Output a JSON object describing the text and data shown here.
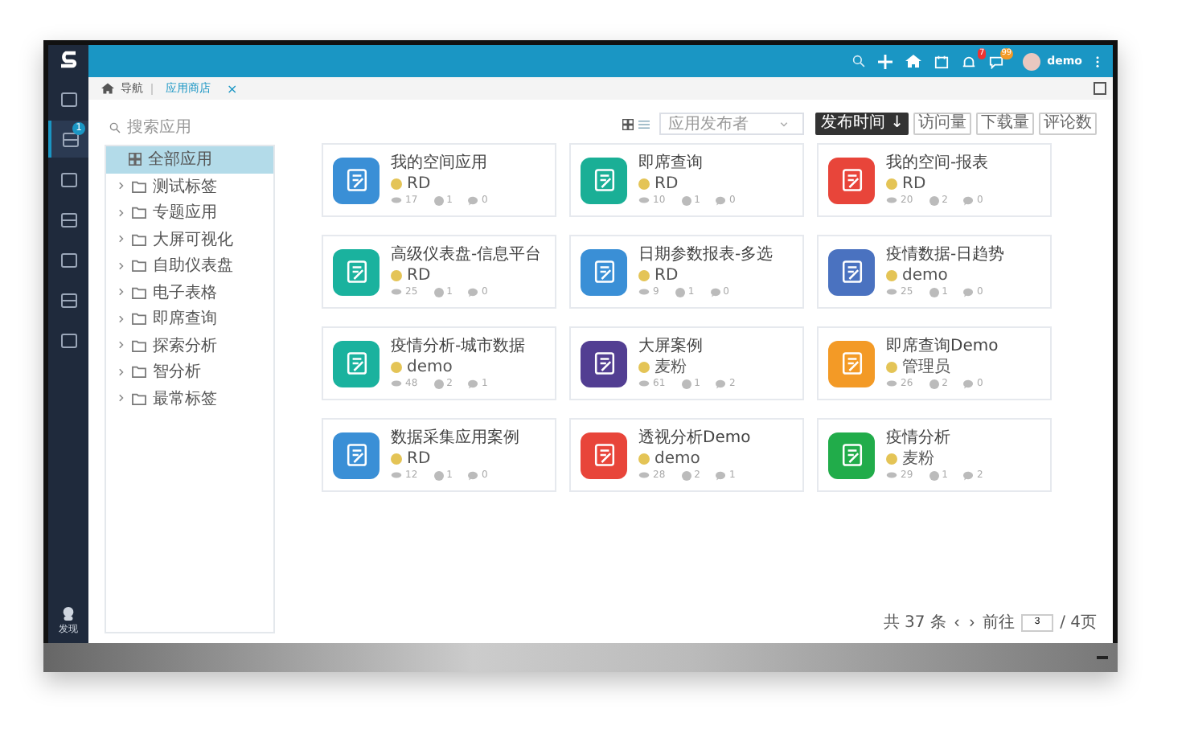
{
  "topbar": {
    "notifications_badge": "7",
    "messages_badge": "99",
    "user": "demo"
  },
  "sidebar": {
    "items": [
      {
        "selected": false
      },
      {
        "selected": true,
        "badge": "1"
      },
      {
        "selected": false
      },
      {
        "selected": false
      },
      {
        "selected": false
      },
      {
        "selected": false
      },
      {
        "selected": false
      }
    ],
    "bottom_label": "发现"
  },
  "breadcrumb": {
    "home": "导航",
    "tab": "应用商店",
    "close": "×"
  },
  "search": {
    "placeholder": "搜索应用"
  },
  "tree": [
    {
      "label": "全部应用",
      "kind": "root",
      "selected": true
    },
    {
      "label": "测试标签",
      "kind": "folder",
      "selected": false
    },
    {
      "label": "专题应用",
      "kind": "folder",
      "selected": false
    },
    {
      "label": "大屏可视化",
      "kind": "folder",
      "selected": false
    },
    {
      "label": "自助仪表盘",
      "kind": "folder",
      "selected": false
    },
    {
      "label": "电子表格",
      "kind": "folder",
      "selected": false
    },
    {
      "label": "即席查询",
      "kind": "folder",
      "selected": false
    },
    {
      "label": "探索分析",
      "kind": "folder",
      "selected": false
    },
    {
      "label": "智分析",
      "kind": "folder",
      "selected": false
    },
    {
      "label": "最常标签",
      "kind": "folder",
      "selected": false
    }
  ],
  "toolbar": {
    "publisher_placeholder": "应用发布者",
    "sort": [
      {
        "label": "发布时间 ↓",
        "selected": true
      },
      {
        "label": "访问量",
        "selected": false
      },
      {
        "label": "下载量",
        "selected": false
      },
      {
        "label": "评论数",
        "selected": false
      }
    ]
  },
  "apps": [
    {
      "title": "我的空间应用",
      "author": "RD",
      "color": "#3a8fd6",
      "views": "17",
      "info": "1",
      "comments": "0"
    },
    {
      "title": "即席查询",
      "author": "RD",
      "color": "#1aaf96",
      "views": "10",
      "info": "1",
      "comments": "0"
    },
    {
      "title": "我的空间-报表",
      "author": "RD",
      "color": "#e8453a",
      "views": "20",
      "info": "2",
      "comments": "0"
    },
    {
      "title": "高级仪表盘-信息平台",
      "author": "RD",
      "color": "#1ab29e",
      "views": "25",
      "info": "1",
      "comments": "0"
    },
    {
      "title": "日期参数报表-多选",
      "author": "RD",
      "color": "#3a8fd6",
      "views": "9",
      "info": "1",
      "comments": "0"
    },
    {
      "title": "疫情数据-日趋势",
      "author": "demo",
      "color": "#4a72c0",
      "views": "25",
      "info": "1",
      "comments": "0"
    },
    {
      "title": "疫情分析-城市数据",
      "author": "demo",
      "color": "#1ab29e",
      "views": "48",
      "info": "2",
      "comments": "1"
    },
    {
      "title": "大屏案例",
      "author": "麦粉",
      "color": "#523e92",
      "views": "61",
      "info": "1",
      "comments": "2"
    },
    {
      "title": "即席查询Demo",
      "author": "管理员",
      "color": "#f39a26",
      "views": "26",
      "info": "2",
      "comments": "0"
    },
    {
      "title": "数据采集应用案例",
      "author": "RD",
      "color": "#3a8fd6",
      "views": "12",
      "info": "1",
      "comments": "0"
    },
    {
      "title": "透视分析Demo",
      "author": "demo",
      "color": "#e8453a",
      "views": "28",
      "info": "2",
      "comments": "1"
    },
    {
      "title": "疫情分析",
      "author": "麦粉",
      "color": "#21ac4a",
      "views": "29",
      "info": "1",
      "comments": "2"
    }
  ],
  "pagination": {
    "total": "共 37 条",
    "prev": "‹",
    "next": "›",
    "goto": "前往",
    "page": "3",
    "pages": "/ 4页"
  }
}
